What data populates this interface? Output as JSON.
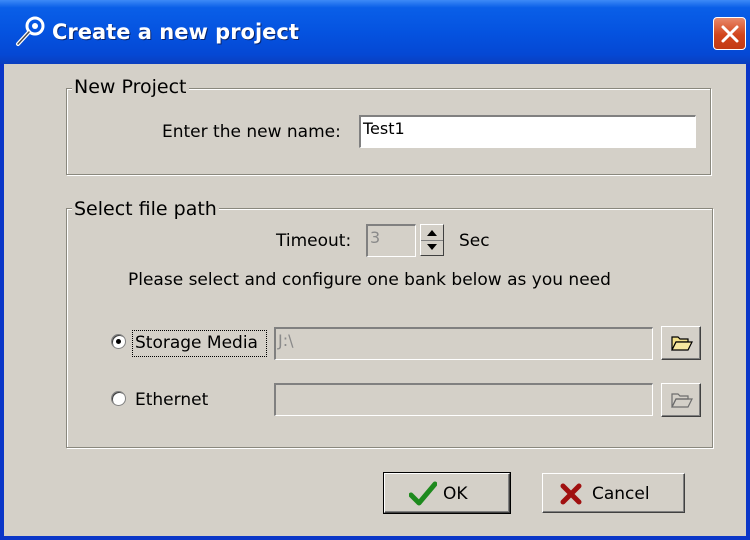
{
  "window": {
    "title": "Create a new project",
    "title_icon": "wrench-icon",
    "close_icon": "close-icon",
    "colors": {
      "titlebar": "#0553e0",
      "close": "#d2451c",
      "face": "#d4d0c8"
    }
  },
  "new_project": {
    "group_label": "New Project",
    "name_label": "Enter the new name:",
    "name_value": "Test1"
  },
  "file_path": {
    "group_label": "Select file path",
    "timeout_label": "Timeout:",
    "timeout_value": "3",
    "timeout_unit": "Sec",
    "instruction": "Please select and configure one bank below as you need",
    "options": [
      {
        "label": "Storage Media",
        "path": "J:\\",
        "selected": true,
        "browse_icon": "folder-open-icon"
      },
      {
        "label": "Ethernet",
        "path": "",
        "selected": false,
        "browse_icon": "folder-open-icon"
      }
    ]
  },
  "buttons": {
    "ok_label": "OK",
    "ok_icon": "checkmark-icon",
    "cancel_label": "Cancel",
    "cancel_icon": "x-mark-icon"
  }
}
